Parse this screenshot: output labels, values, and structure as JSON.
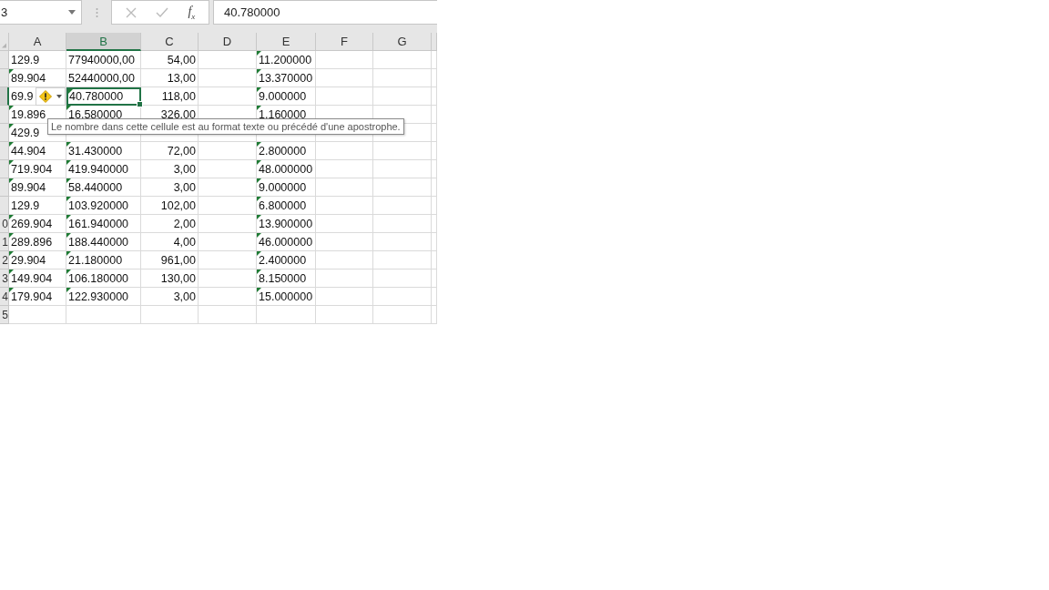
{
  "formula_bar": {
    "name_box": "3",
    "function_label": "f$_{x}$",
    "formula": "40.780000"
  },
  "columns": [
    {
      "label": "A",
      "selected": false
    },
    {
      "label": "B",
      "selected": true
    },
    {
      "label": "C",
      "selected": false
    },
    {
      "label": "D",
      "selected": false
    },
    {
      "label": "E",
      "selected": false
    },
    {
      "label": "F",
      "selected": false
    },
    {
      "label": "G",
      "selected": false
    }
  ],
  "rows": [
    {
      "selected": false,
      "cells": [
        {
          "text": "129.9",
          "kind": "text",
          "flag": false,
          "selected": false
        },
        {
          "text": "77940000,00",
          "kind": "text",
          "flag": false,
          "selected": false
        },
        {
          "text": "54,00",
          "kind": "number",
          "flag": false,
          "selected": false
        },
        null,
        {
          "text": "11.200000",
          "kind": "text",
          "flag": true,
          "selected": false
        },
        null,
        null
      ]
    },
    {
      "selected": false,
      "cells": [
        {
          "text": "89.904",
          "kind": "text",
          "flag": true,
          "selected": false
        },
        {
          "text": "52440000,00",
          "kind": "text",
          "flag": false,
          "selected": false
        },
        {
          "text": "13,00",
          "kind": "number",
          "flag": false,
          "selected": false
        },
        null,
        {
          "text": "13.370000",
          "kind": "text",
          "flag": true,
          "selected": false
        },
        null,
        null
      ]
    },
    {
      "selected": true,
      "cells": [
        {
          "text": "69.9",
          "kind": "text",
          "flag": false,
          "selected": false,
          "error_tag": {
            "kind": "warning"
          }
        },
        {
          "text": "40.780000",
          "kind": "text",
          "flag": true,
          "selected": true
        },
        {
          "text": "118,00",
          "kind": "number",
          "flag": false,
          "selected": false
        },
        null,
        {
          "text": "9.000000",
          "kind": "text",
          "flag": true,
          "selected": false
        },
        null,
        null
      ]
    },
    {
      "selected": false,
      "cells": [
        {
          "text": "19.896",
          "kind": "text",
          "flag": true,
          "selected": false
        },
        {
          "text": "16.580000",
          "kind": "text",
          "flag": true,
          "selected": false
        },
        {
          "text": "326,00",
          "kind": "number",
          "flag": false,
          "selected": false
        },
        null,
        {
          "text": "1.160000",
          "kind": "text",
          "flag": true,
          "selected": false
        },
        null,
        null
      ]
    },
    {
      "selected": false,
      "cells": [
        {
          "text": "429.9",
          "kind": "text",
          "flag": true,
          "selected": false
        },
        null,
        null,
        null,
        null,
        null,
        null
      ]
    },
    {
      "selected": false,
      "cells": [
        {
          "text": "44.904",
          "kind": "text",
          "flag": true,
          "selected": false
        },
        {
          "text": "31.430000",
          "kind": "text",
          "flag": true,
          "selected": false
        },
        {
          "text": "72,00",
          "kind": "number",
          "flag": false,
          "selected": false
        },
        null,
        {
          "text": "2.800000",
          "kind": "text",
          "flag": true,
          "selected": false
        },
        null,
        null
      ]
    },
    {
      "selected": false,
      "cells": [
        {
          "text": "719.904",
          "kind": "text",
          "flag": true,
          "selected": false
        },
        {
          "text": "419.940000",
          "kind": "text",
          "flag": true,
          "selected": false
        },
        {
          "text": "3,00",
          "kind": "number",
          "flag": false,
          "selected": false
        },
        null,
        {
          "text": "48.000000",
          "kind": "text",
          "flag": true,
          "selected": false
        },
        null,
        null
      ]
    },
    {
      "selected": false,
      "cells": [
        {
          "text": "89.904",
          "kind": "text",
          "flag": true,
          "selected": false
        },
        {
          "text": "58.440000",
          "kind": "text",
          "flag": true,
          "selected": false
        },
        {
          "text": "3,00",
          "kind": "number",
          "flag": false,
          "selected": false
        },
        null,
        {
          "text": "9.000000",
          "kind": "text",
          "flag": true,
          "selected": false
        },
        null,
        null
      ]
    },
    {
      "selected": false,
      "cells": [
        {
          "text": "129.9",
          "kind": "text",
          "flag": false,
          "selected": false
        },
        {
          "text": "103.920000",
          "kind": "text",
          "flag": true,
          "selected": false
        },
        {
          "text": "102,00",
          "kind": "number",
          "flag": false,
          "selected": false
        },
        null,
        {
          "text": "6.800000",
          "kind": "text",
          "flag": true,
          "selected": false
        },
        null,
        null
      ]
    },
    {
      "header": "0",
      "selected": false,
      "cells": [
        {
          "text": "269.904",
          "kind": "text",
          "flag": true,
          "selected": false
        },
        {
          "text": "161.940000",
          "kind": "text",
          "flag": true,
          "selected": false
        },
        {
          "text": "2,00",
          "kind": "number",
          "flag": false,
          "selected": false
        },
        null,
        {
          "text": "13.900000",
          "kind": "text",
          "flag": true,
          "selected": false
        },
        null,
        null
      ]
    },
    {
      "header": "1",
      "selected": false,
      "cells": [
        {
          "text": "289.896",
          "kind": "text",
          "flag": true,
          "selected": false
        },
        {
          "text": "188.440000",
          "kind": "text",
          "flag": true,
          "selected": false
        },
        {
          "text": "4,00",
          "kind": "number",
          "flag": false,
          "selected": false
        },
        null,
        {
          "text": "46.000000",
          "kind": "text",
          "flag": true,
          "selected": false
        },
        null,
        null
      ]
    },
    {
      "header": "2",
      "selected": false,
      "cells": [
        {
          "text": "29.904",
          "kind": "text",
          "flag": true,
          "selected": false
        },
        {
          "text": "21.180000",
          "kind": "text",
          "flag": true,
          "selected": false
        },
        {
          "text": "961,00",
          "kind": "number",
          "flag": false,
          "selected": false
        },
        null,
        {
          "text": "2.400000",
          "kind": "text",
          "flag": true,
          "selected": false
        },
        null,
        null
      ]
    },
    {
      "header": "3",
      "selected": false,
      "cells": [
        {
          "text": "149.904",
          "kind": "text",
          "flag": true,
          "selected": false
        },
        {
          "text": "106.180000",
          "kind": "text",
          "flag": true,
          "selected": false
        },
        {
          "text": "130,00",
          "kind": "number",
          "flag": false,
          "selected": false
        },
        null,
        {
          "text": "8.150000",
          "kind": "text",
          "flag": true,
          "selected": false
        },
        null,
        null
      ]
    },
    {
      "header": "4",
      "selected": false,
      "cells": [
        {
          "text": "179.904",
          "kind": "text",
          "flag": true,
          "selected": false
        },
        {
          "text": "122.930000",
          "kind": "text",
          "flag": true,
          "selected": false
        },
        {
          "text": "3,00",
          "kind": "number",
          "flag": false,
          "selected": false
        },
        null,
        {
          "text": "15.000000",
          "kind": "text",
          "flag": true,
          "selected": false
        },
        null,
        null
      ]
    },
    {
      "header": "5",
      "selected": false,
      "cells": [
        null,
        null,
        null,
        null,
        null,
        null,
        null
      ]
    }
  ],
  "tooltip": "Le nombre dans cette cellule est au format texte ou précédé d'une apostrophe."
}
